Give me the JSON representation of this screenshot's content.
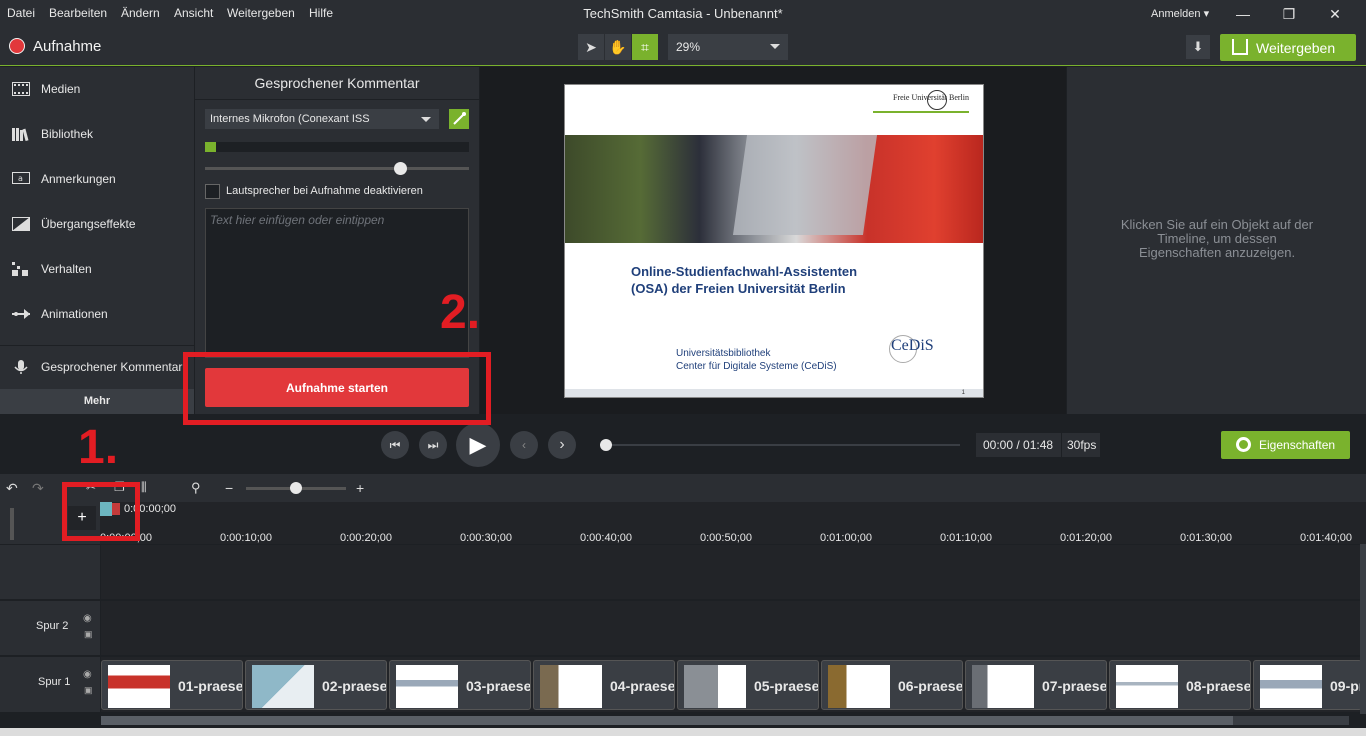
{
  "menu": {
    "items": [
      "Datei",
      "Bearbeiten",
      "Ändern",
      "Ansicht",
      "Weitergeben",
      "Hilfe"
    ],
    "app_title": "TechSmith Camtasia - Unbenannt*",
    "sign_in": "Anmelden",
    "minimize": "—",
    "maximize": "❐",
    "close": "✕"
  },
  "toolbar": {
    "record_label": "Aufnahme",
    "zoom_value": "29%",
    "download_icon": "⬇",
    "share_label": "Weitergeben"
  },
  "sidebar": {
    "items": [
      {
        "label": "Medien",
        "icon": "film-icon"
      },
      {
        "label": "Bibliothek",
        "icon": "library-icon"
      },
      {
        "label": "Anmerkungen",
        "icon": "annotation-icon"
      },
      {
        "label": "Übergangseffekte",
        "icon": "transition-icon"
      },
      {
        "label": "Verhalten",
        "icon": "behavior-icon"
      },
      {
        "label": "Animationen",
        "icon": "animation-icon"
      },
      {
        "label": "Gesprochener Kommentar",
        "icon": "microphone-icon"
      }
    ],
    "more_label": "Mehr"
  },
  "narration": {
    "title": "Gesprochener Kommentar",
    "mic_device": "Internes Mikrofon (Conexant ISS",
    "input_level": 0.04,
    "volume_level": 0.74,
    "mute_speakers_label": "Lautsprecher bei Aufnahme deaktivieren",
    "script_placeholder": "Text hier einfügen oder eintippen",
    "start_label": "Aufnahme starten"
  },
  "slide": {
    "university_logo": "Freie Universität Berlin",
    "title": "Online-Studienfachwahl-Assistenten\n(OSA) der Freien Universität Berlin",
    "org": "Universitätsbibliothek\nCenter für Digitale Systeme (CeDiS)",
    "cedis_logo": "CeDiS",
    "page_number": "1"
  },
  "properties": {
    "hint": "Klicken Sie auf ein Objekt auf der Timeline, um dessen Eigenschaften anzuzeigen."
  },
  "playback": {
    "time": "00:00 / 01:48",
    "fps": "30fps",
    "properties_label": "Eigenschaften",
    "position": 0.0
  },
  "timeline": {
    "playhead_time": "0:00:00;00",
    "ticks": [
      "0:00:00;00",
      "0:00:10;00",
      "0:00:20;00",
      "0:00:30;00",
      "0:00:40;00",
      "0:00:50;00",
      "0:01:00;00",
      "0:01:10;00",
      "0:01:20;00",
      "0:01:30;00",
      "0:01:40;00"
    ],
    "add_track": "+",
    "tracks": [
      {
        "name": ""
      },
      {
        "name": "Spur 2"
      },
      {
        "name": "Spur 1"
      }
    ],
    "clips": [
      "01-praesen",
      "02-praese",
      "03-praese",
      "04-praese",
      "05-praese",
      "06-praese",
      "07-praese",
      "08-praese",
      "09-pr"
    ]
  },
  "annotations": {
    "step1": "1.",
    "step2": "2."
  },
  "colors": {
    "accent": "#7ab22d",
    "record": "#e2383b",
    "annotation": "#e21d23"
  }
}
